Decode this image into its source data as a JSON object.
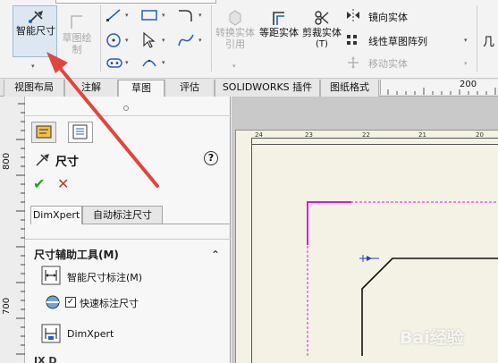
{
  "ribbon": {
    "smart_dimension": {
      "label": "智能尺寸",
      "icon": "smart-dimension-icon",
      "dropdown": "▾"
    },
    "sketch_drawing": {
      "label": "草图绘制",
      "icon": "sketch-drawing-icon",
      "disabled": true
    },
    "convert_entities": {
      "label": "转换实体引用",
      "disabled": true
    },
    "offset_entities": {
      "label": "等距实体"
    },
    "trim_entities": {
      "label": "剪裁实体"
    },
    "trim_shortcut": "(T)",
    "mirror_entities": {
      "label": "镜向实体"
    },
    "linear_pattern": {
      "label": "线性草图阵列"
    },
    "move_entities": {
      "label": "移动实体",
      "disabled": true
    },
    "partial_right": "几"
  },
  "tabs": [
    {
      "label": "视图布局",
      "active": false
    },
    {
      "label": "注解",
      "active": false
    },
    {
      "label": "草图",
      "active": true
    },
    {
      "label": "评估",
      "active": false
    },
    {
      "label": "SOLIDWORKS 插件",
      "active": false
    },
    {
      "label": "图纸格式",
      "active": false
    }
  ],
  "ruler": {
    "h_label": "200",
    "v_labels": [
      "800",
      "700"
    ]
  },
  "panel": {
    "title": "尺寸",
    "help": "?",
    "ok": "✔",
    "cancel": "✕",
    "subtabs": [
      {
        "label": "DimXpert",
        "active": true
      },
      {
        "label": "自动标注尺寸",
        "active": false
      }
    ],
    "section": {
      "title": "尺寸辅助工具(M)",
      "collapse": "⌃"
    },
    "items": [
      {
        "label": "智能尺寸标注(M)"
      },
      {
        "label": "快速标注尺寸",
        "checked": true
      },
      {
        "label": "DimXpert"
      }
    ],
    "next_section_partial": "IX D"
  },
  "sheet": {
    "zone_numbers": [
      "24",
      "23",
      "22",
      "21",
      "20"
    ]
  },
  "watermark": "Bai经验",
  "colors": {
    "arrow": "#e0463e",
    "magenta": "#e015e0",
    "accent_blue": "#1f5fc4"
  }
}
